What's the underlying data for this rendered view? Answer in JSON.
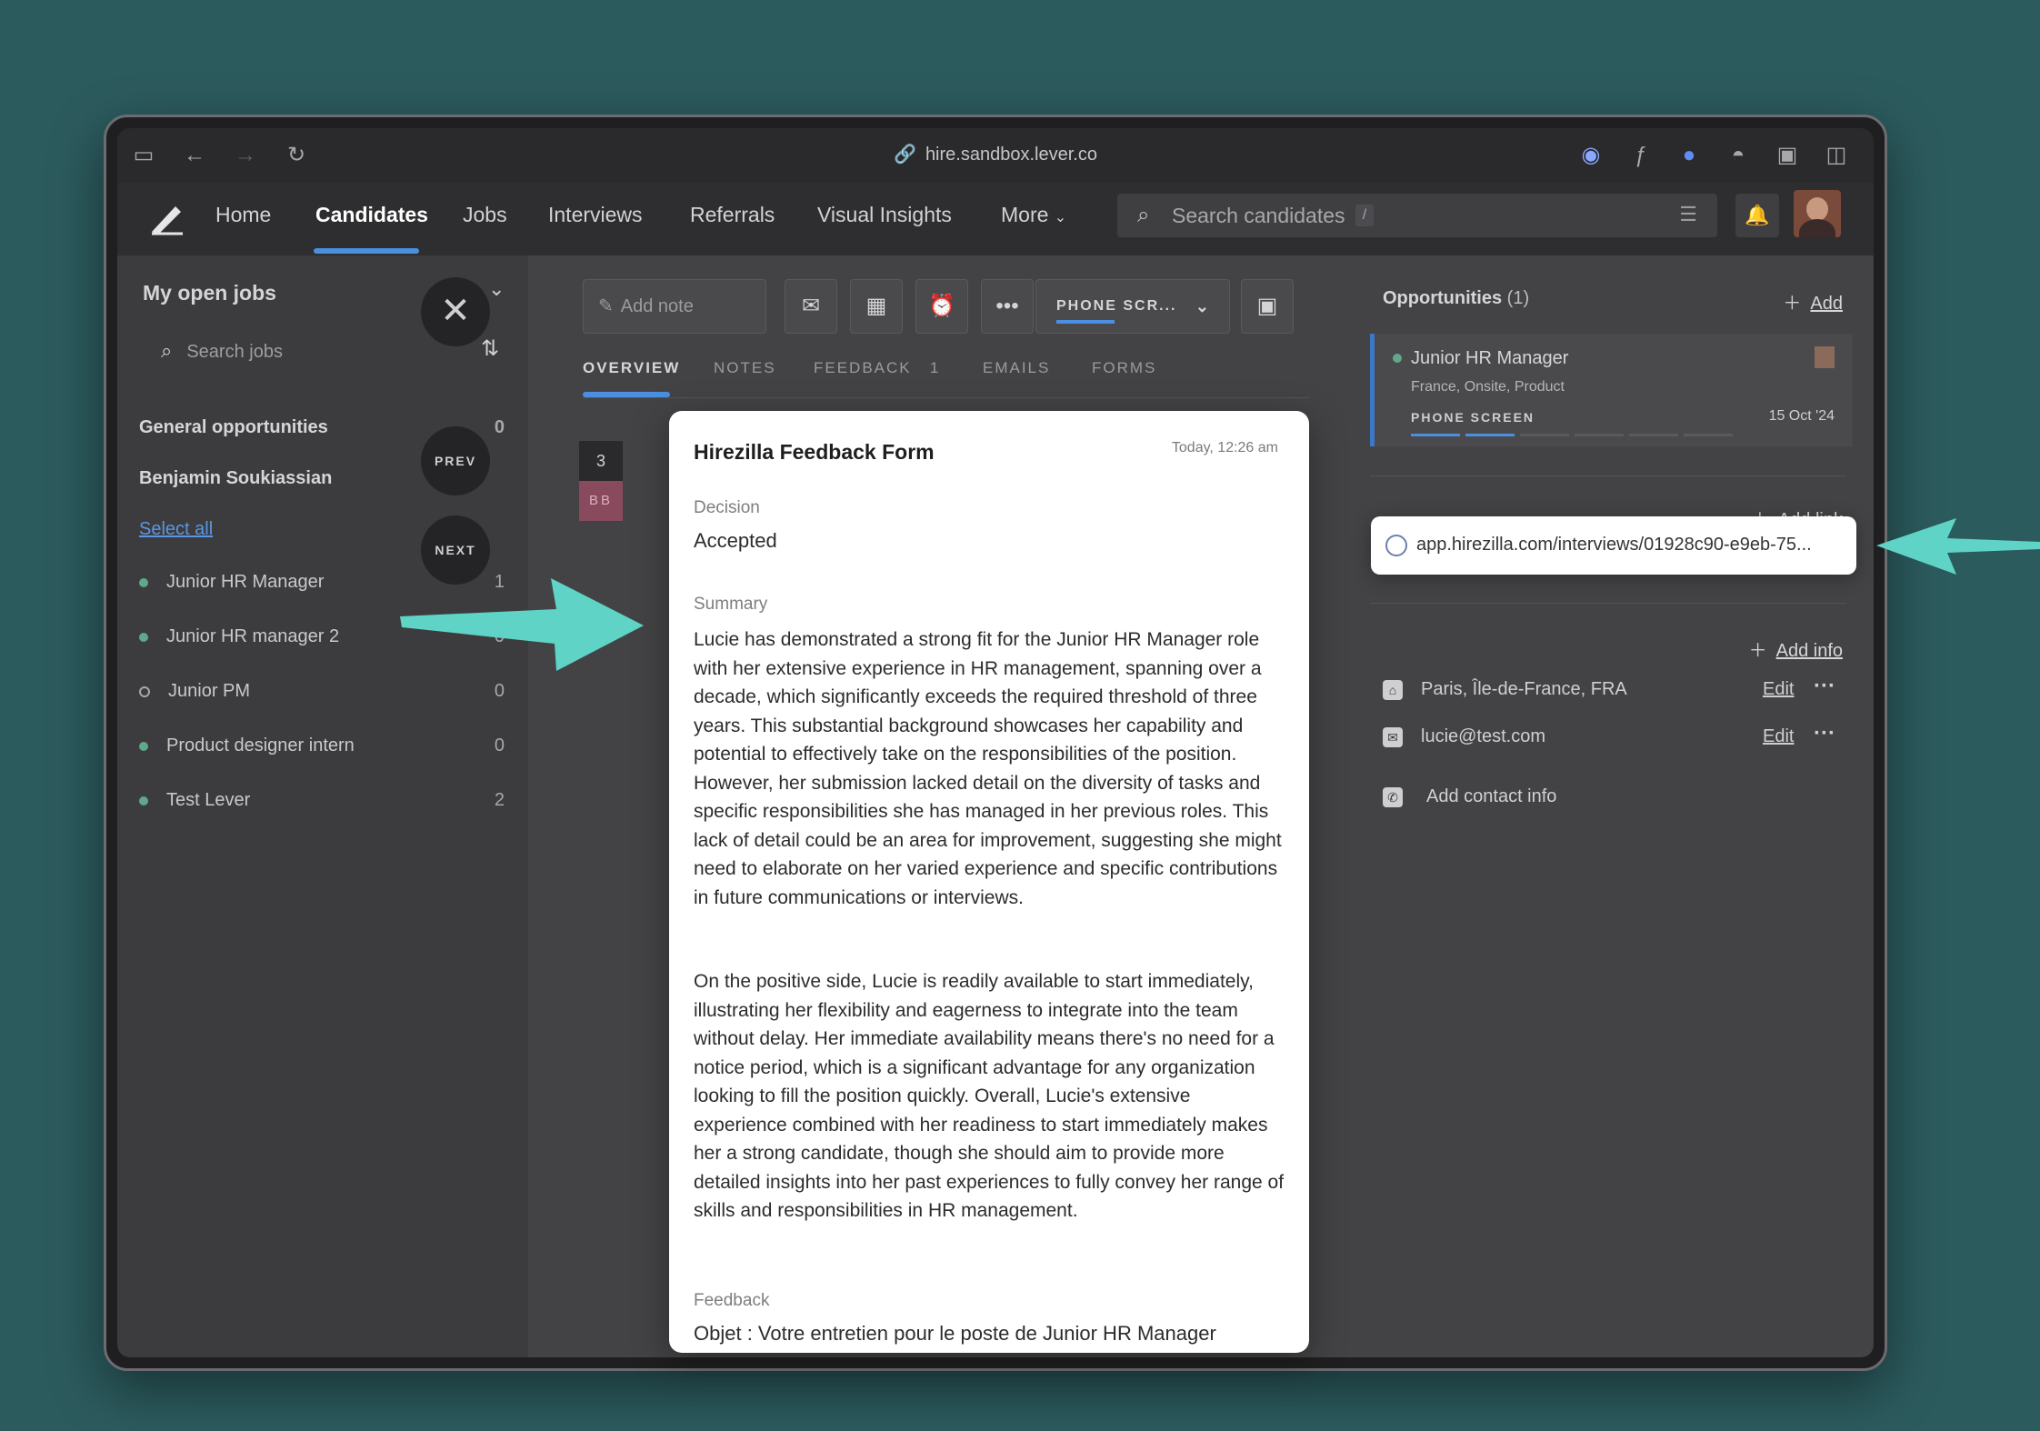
{
  "browser": {
    "url": "hire.sandbox.lever.co"
  },
  "nav": {
    "items": [
      "Home",
      "Candidates",
      "Jobs",
      "Interviews",
      "Referrals",
      "Visual Insights",
      "More"
    ],
    "active": "Candidates",
    "search_placeholder": "Search candidates",
    "search_shortcut": "/"
  },
  "sidebar": {
    "title": "My open jobs",
    "search_placeholder": "Search jobs",
    "sections": [
      {
        "label": "General opportunities",
        "count": "0"
      },
      {
        "label": "Benjamin Soukiassian",
        "count": ""
      }
    ],
    "select_all": "Select all",
    "jobs": [
      {
        "label": "Junior HR Manager",
        "count": "1",
        "status": "filled"
      },
      {
        "label": "Junior HR manager 2",
        "count": "0",
        "status": "filled"
      },
      {
        "label": "Junior PM",
        "count": "0",
        "status": "hollow"
      },
      {
        "label": "Product designer intern",
        "count": "0",
        "status": "filled"
      },
      {
        "label": "Test Lever",
        "count": "2",
        "status": "filled"
      }
    ],
    "prev_label": "PREV",
    "next_label": "NEXT"
  },
  "toolbar": {
    "add_note": "Add note",
    "stage": "PHONE SCR..."
  },
  "tabs": [
    {
      "label": "OVERVIEW",
      "active": true
    },
    {
      "label": "NOTES"
    },
    {
      "label": "FEEDBACK",
      "badge": "1"
    },
    {
      "label": "EMAILS"
    },
    {
      "label": "FORMS"
    }
  ],
  "timeline": {
    "count": "3",
    "initials": "BB"
  },
  "feedback_card": {
    "title": "Hirezilla Feedback Form",
    "time": "Today, 12:26 am",
    "decision_label": "Decision",
    "decision": "Accepted",
    "summary_label": "Summary",
    "summary_p1": "Lucie has demonstrated a strong fit for the Junior HR Manager role with her extensive experience in HR management, spanning over a decade, which significantly exceeds the required threshold of three years. This substantial background showcases her capability and potential to effectively take on the responsibilities of the position. However, her submission lacked detail on the diversity of tasks and specific responsibilities she has managed in her previous roles. This lack of detail could be an area for improvement, suggesting she might need to elaborate on her varied experience and specific contributions in future communications or interviews.",
    "summary_p2": "On the positive side, Lucie is readily available to start immediately, illustrating her flexibility and eagerness to integrate into the team without delay. Her immediate availability means there's no need for a notice period, which is a significant advantage for any organization looking to fill the position quickly. Overall, Lucie's extensive experience combined with her readiness to start immediately makes her a strong candidate, though she should aim to provide more detailed insights into her past experiences to fully convey her range of skills and responsibilities in HR management.",
    "feedback_label": "Feedback",
    "feedback_text": "Objet : Votre entretien pour le poste de Junior HR Manager"
  },
  "opportunities": {
    "title": "Opportunities",
    "count": "(1)",
    "add": "Add",
    "job_title": "Junior HR Manager",
    "job_meta": "France, Onsite, Product",
    "stage": "PHONE SCREEN",
    "date": "15 Oct '24",
    "progress": 2,
    "progress_total": 6
  },
  "links": {
    "add_link": "Add link",
    "url": "app.hirezilla.com/interviews/01928c90-e9eb-75..."
  },
  "info": {
    "add_info": "Add info",
    "location": "Paris, Île-de-France, FRA",
    "email": "lucie@test.com",
    "edit": "Edit",
    "add_contact": "Add contact info"
  },
  "colors": {
    "background": "#2c5b5e",
    "accent": "#4a8fe0",
    "arrow": "#5fd3c6"
  }
}
